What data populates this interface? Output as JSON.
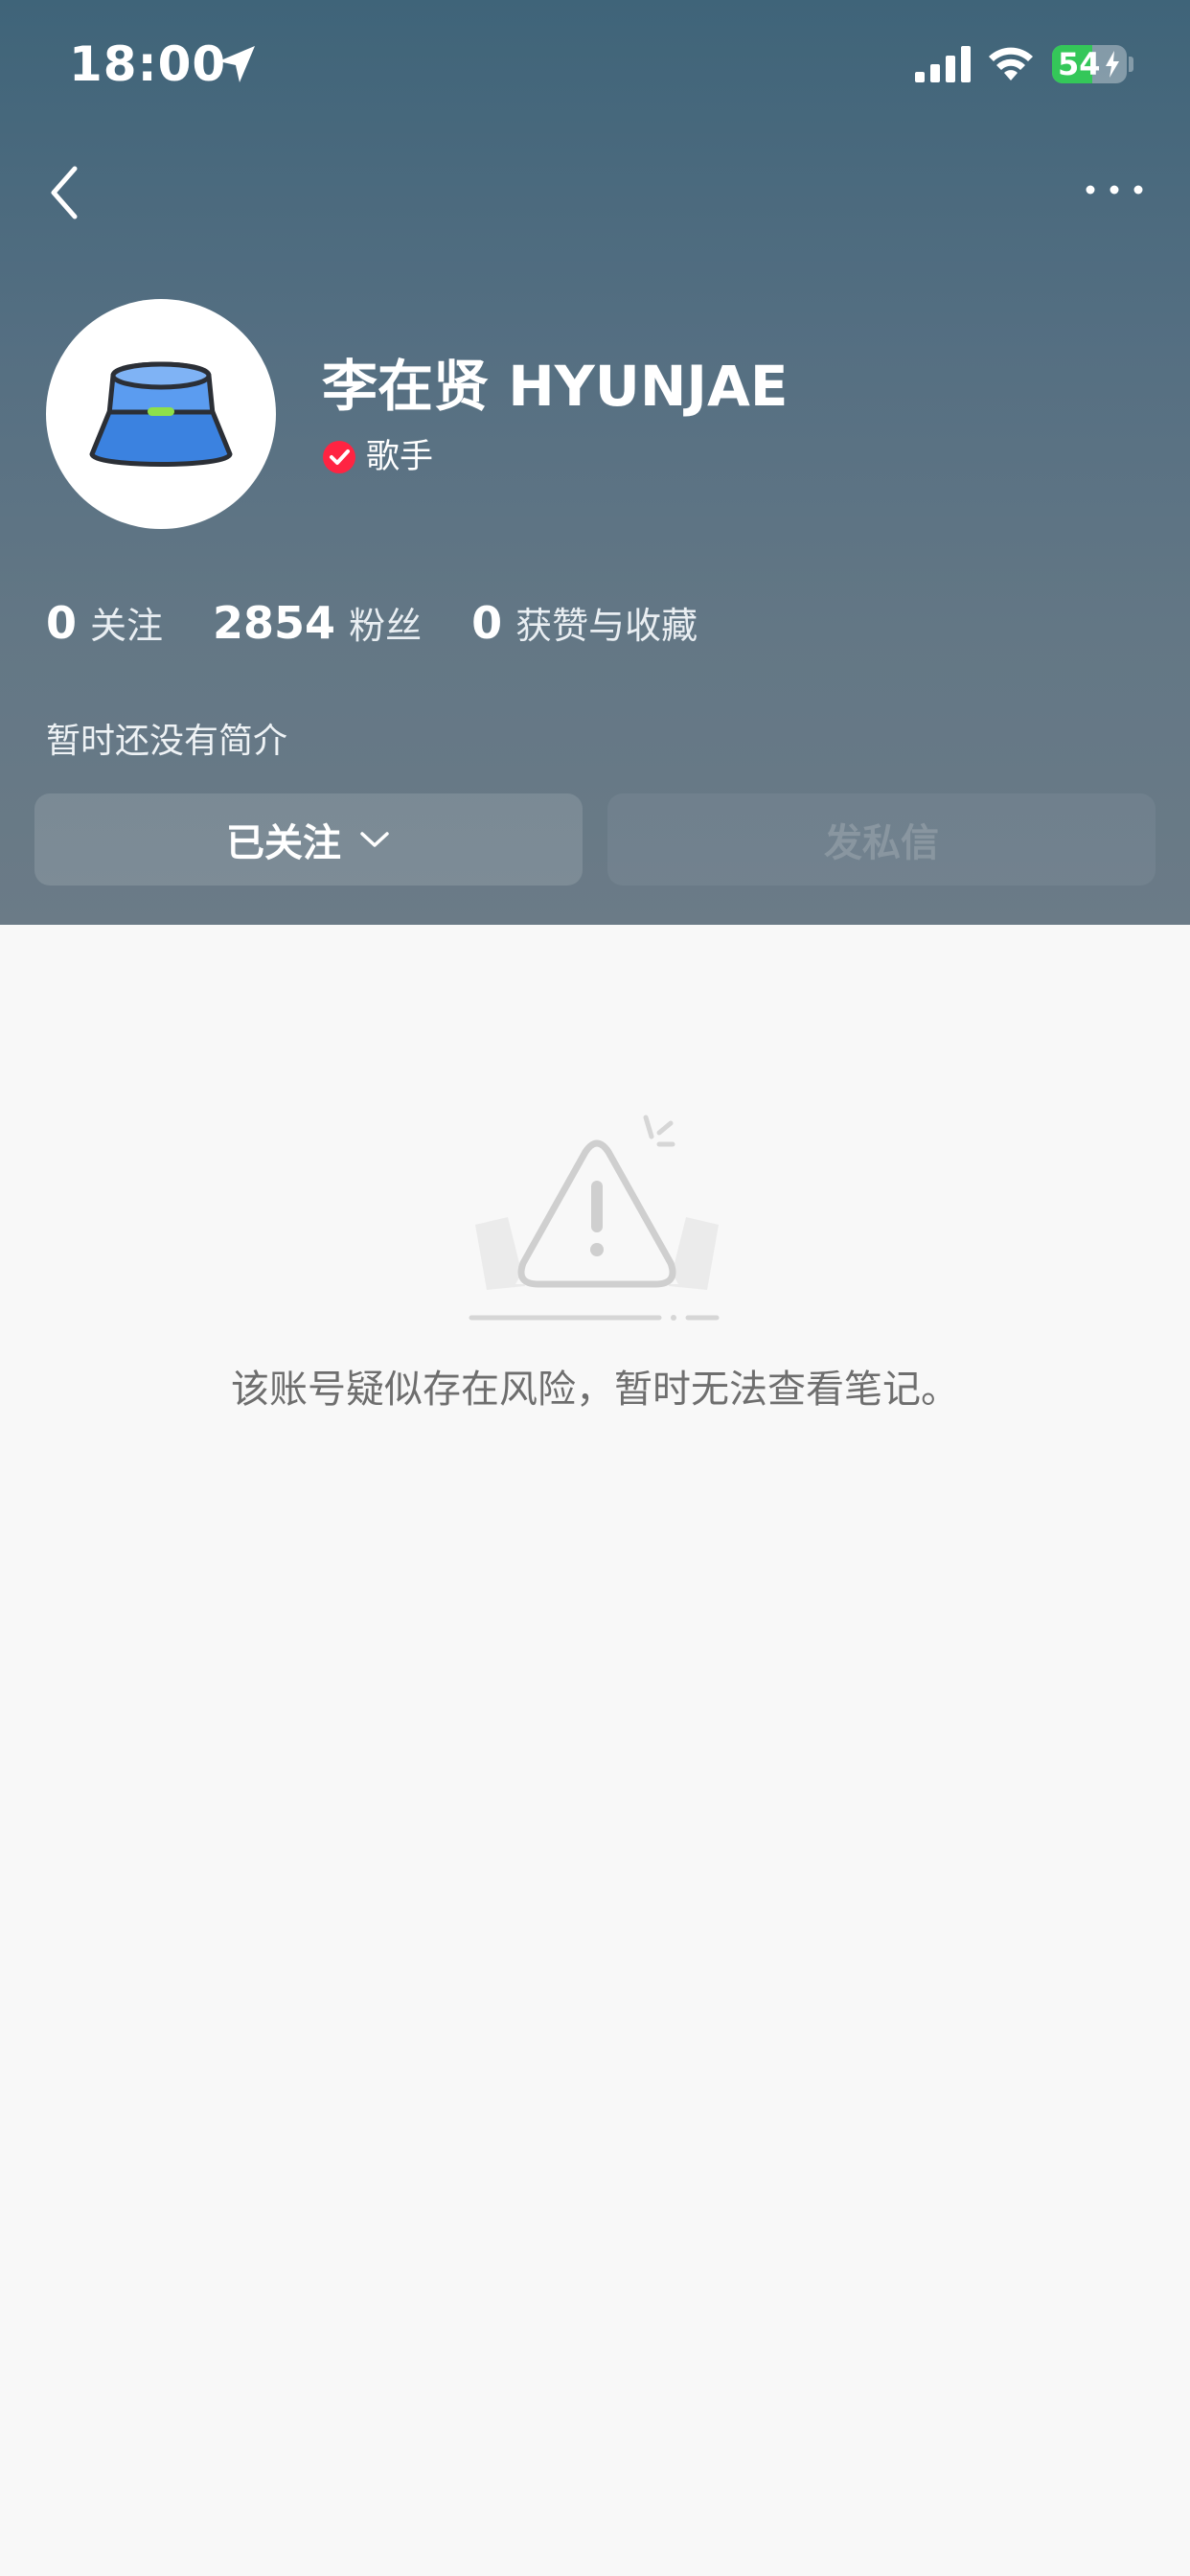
{
  "status_bar": {
    "time": "18:00",
    "battery_level": "54",
    "battery_percent": 54,
    "icons": [
      "location-arrow-icon",
      "cellular-signal-icon",
      "wifi-icon",
      "battery-icon",
      "charging-bolt-icon"
    ]
  },
  "nav": {
    "back_icon": "chevron-left-icon",
    "more_icon": "more-dots-icon"
  },
  "profile": {
    "avatar_icon": "bucket-hat-icon",
    "name": "李在贤 HYUNJAE",
    "verified_icon": "verified-check-icon",
    "tag": "歌手",
    "stats": [
      {
        "value": "0",
        "label": "关注"
      },
      {
        "value": "2854",
        "label": "粉丝"
      },
      {
        "value": "0",
        "label": "获赞与收藏"
      }
    ],
    "bio": "暂时还没有简介"
  },
  "actions": {
    "follow_label": "已关注",
    "message_label": "发私信"
  },
  "empty_state": {
    "icon": "warning-triangle-icon",
    "message": "该账号疑似存在风险，暂时无法查看笔记。"
  },
  "colors": {
    "header_top": "#3f6479",
    "header_bottom": "#6b7b87",
    "page_background": "#f8f8f8",
    "verified_red": "#ff2442",
    "battery_green": "#34c759",
    "avatar_blue": "#3b82e0"
  }
}
